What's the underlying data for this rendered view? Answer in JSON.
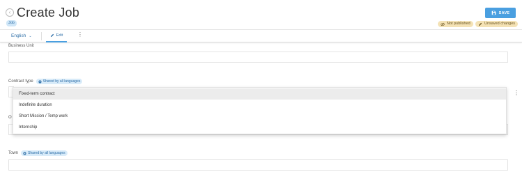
{
  "header": {
    "title": "Create Job",
    "type_badge": "Job",
    "save_label": "SAVE",
    "statuses": {
      "not_published": "Not published",
      "unsaved": "Unsaved changes"
    }
  },
  "toolbar": {
    "language": "English",
    "edit_tab": "Edit"
  },
  "form": {
    "shared_label": "Shared by all languages",
    "business_unit": {
      "label": "Business Unit",
      "value": ""
    },
    "contract_type": {
      "label": "Contract type",
      "options": [
        "Fixed-term contract",
        "Indefinite duration",
        "Short Mission / Temp work",
        "Internship"
      ],
      "highlighted_index": 0
    },
    "partially_hidden_label": "O",
    "town": {
      "label": "Town",
      "value": ""
    }
  },
  "colors": {
    "accent": "#4a9fe0",
    "status_badge": "#f4e2b5",
    "shared_badge": "#d8ebf9"
  }
}
